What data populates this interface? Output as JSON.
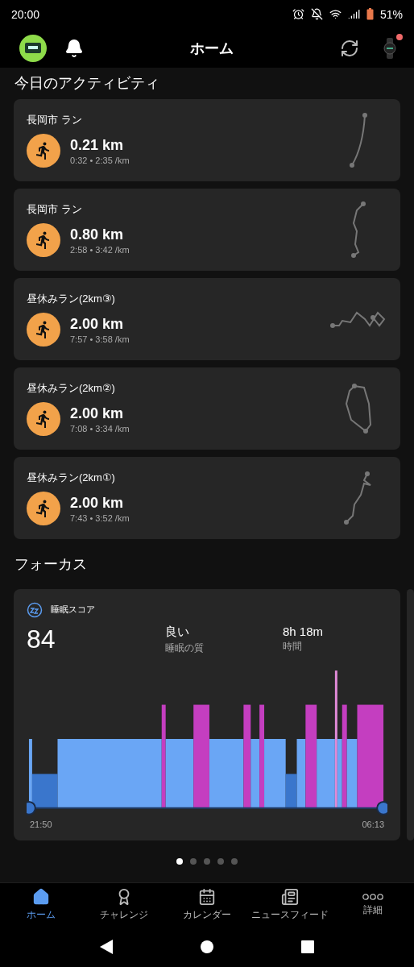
{
  "status_bar": {
    "time": "20:00",
    "battery": "51%"
  },
  "header": {
    "title": "ホーム",
    "notification_dot": true
  },
  "activities_title": "今日のアクティビティ",
  "activities": [
    {
      "title": "長岡市 ラン",
      "distance": "0.21 km",
      "stats": "0:32 • 2:35 /km"
    },
    {
      "title": "長岡市 ラン",
      "distance": "0.80 km",
      "stats": "2:58 • 3:42 /km"
    },
    {
      "title": "昼休みラン(2km③)",
      "distance": "2.00 km",
      "stats": "7:57 • 3:58 /km"
    },
    {
      "title": "昼休みラン(2km②)",
      "distance": "2.00 km",
      "stats": "7:08 • 3:34 /km"
    },
    {
      "title": "昼休みラン(2km①)",
      "distance": "2.00 km",
      "stats": "7:43 • 3:52 /km"
    }
  ],
  "focus_title": "フォーカス",
  "sleep": {
    "title": "睡眠スコア",
    "score": "84",
    "quality": "良い",
    "quality_label": "睡眠の質",
    "duration": "8h 18m",
    "duration_label": "時間",
    "start_time": "21:50",
    "end_time": "06:13"
  },
  "pager": [
    {
      "selected": true
    },
    {
      "selected": false
    },
    {
      "selected": false
    },
    {
      "selected": false
    },
    {
      "selected": false
    }
  ],
  "bottom_nav": [
    {
      "kind": "home",
      "label": "ホーム",
      "selected": true
    },
    {
      "kind": "challenge",
      "label": "チャレンジ",
      "selected": false
    },
    {
      "kind": "calendar",
      "label": "カレンダー",
      "selected": false
    },
    {
      "kind": "news",
      "label": "ニュースフィード",
      "selected": false
    },
    {
      "kind": "more",
      "label": "詳細",
      "selected": false
    }
  ]
}
